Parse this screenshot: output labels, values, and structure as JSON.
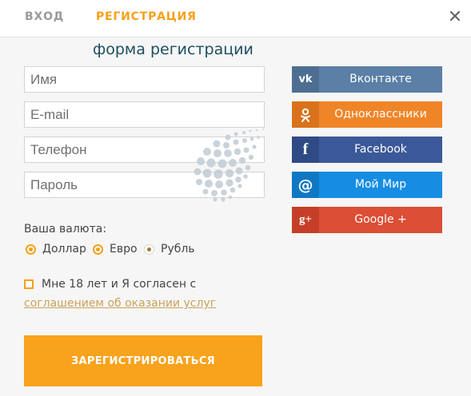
{
  "tabs": {
    "login": "ВХОД",
    "register": "РЕГИСТРАЦИЯ"
  },
  "close_glyph": "✕",
  "form": {
    "title": "форма регистрации",
    "name_placeholder": "Имя",
    "email_placeholder": "E-mail",
    "phone_placeholder": "Телефон",
    "password_placeholder": "Пароль"
  },
  "social": [
    {
      "label": "Вконтакте",
      "icon": "vk-icon",
      "glyph": "vk",
      "color": "#5b7fa6",
      "icon_color": "#4d6e92"
    },
    {
      "label": "Одноклассники",
      "icon": "odnoklassniki-icon",
      "glyph": "ok",
      "color": "#f08528",
      "icon_color": "#d9721a"
    },
    {
      "label": "Facebook",
      "icon": "facebook-icon",
      "glyph": "f",
      "color": "#3b5998",
      "icon_color": "#2f4b85"
    },
    {
      "label": "Мой Мир",
      "icon": "moymir-icon",
      "glyph": "@",
      "color": "#168de2",
      "icon_color": "#0f78c4"
    },
    {
      "label": "Google +",
      "icon": "google-plus-icon",
      "glyph": "g+",
      "color": "#dc4e35",
      "icon_color": "#c53f28"
    }
  ],
  "currency": {
    "label": "Ваша валюта:",
    "options": [
      "Доллар",
      "Евро",
      "Рубль"
    ],
    "selected": "Рубль"
  },
  "agreement": {
    "text": "Мне 18 лет и Я согласен с",
    "link": "соглашением об оказании услуг",
    "checked": false
  },
  "submit_label": "ЗАРЕГИСТРИРОВАТЬСЯ",
  "colors": {
    "accent": "#f9a21c",
    "title": "#1d4f5f"
  }
}
